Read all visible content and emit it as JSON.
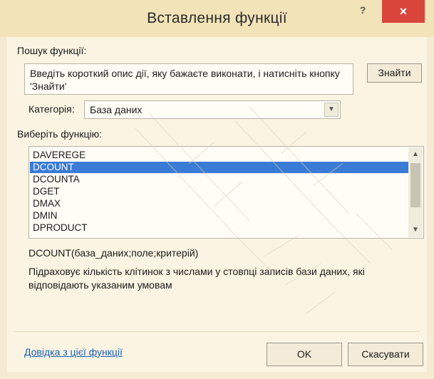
{
  "window": {
    "title": "Вставлення функції",
    "help_glyph": "?",
    "close_glyph": "×"
  },
  "search": {
    "label": "Пошук функції:",
    "value": "Введіть короткий опис дії, яку бажаєте виконати, і натисніть кнопку 'Знайти'",
    "button_label": "Знайти"
  },
  "category": {
    "label": "Категорія:",
    "selected": "База даних"
  },
  "function_list": {
    "label": "Виберіть функцію:",
    "items": [
      "DAVEREGE",
      "DCOUNT",
      "DCOUNTA",
      "DGET",
      "DMAX",
      "DMIN",
      "DPRODUCT"
    ],
    "selected": "DCOUNT"
  },
  "description": {
    "signature": "DCOUNT(база_даних;поле;критерій)",
    "text": "Підраховує кількість клітинок з числами у стовпці записів бази даних, які відповідають указаним умовам"
  },
  "footer": {
    "help_link": "Довідка з цієї функції",
    "ok_label": "OK",
    "cancel_label": "Скасувати"
  },
  "colors": {
    "selection": "#3a7bd5",
    "close_button": "#d9443b",
    "link": "#1a5fb4"
  },
  "icons": {
    "dropdown": "chevron-down-icon",
    "scroll_up": "chevron-up-icon",
    "scroll_down": "chevron-down-icon"
  }
}
